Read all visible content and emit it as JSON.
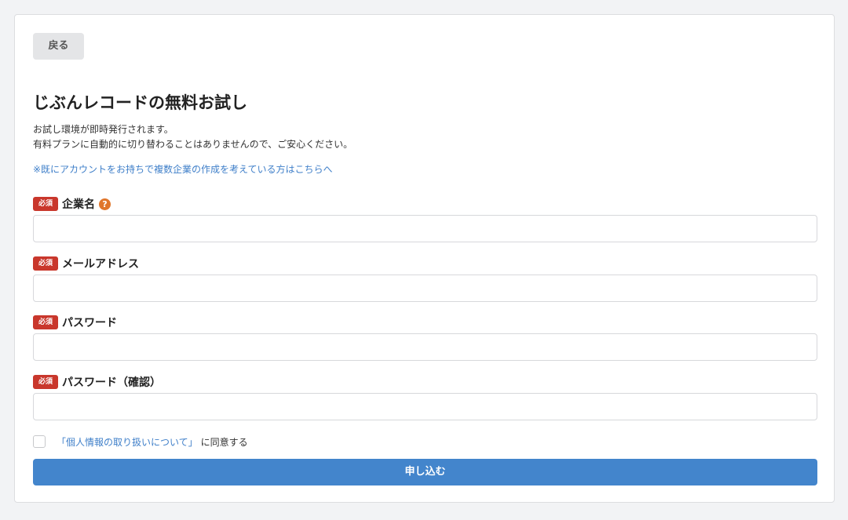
{
  "back_label": "戻る",
  "title": "じぶんレコードの無料お試し",
  "description": [
    "お試し環境が即時発行されます。",
    "有料プランに自動的に切り替わることはありませんので、ご安心ください。"
  ],
  "existing_account_link": "※既にアカウントをお持ちで複数企業の作成を考えている方はこちらへ",
  "required_badge": "必須",
  "help_icon": "?",
  "fields": [
    {
      "label": "企業名",
      "value": "",
      "has_help": true
    },
    {
      "label": "メールアドレス",
      "value": ""
    },
    {
      "label": "パスワード",
      "value": ""
    },
    {
      "label": "パスワード（確認）",
      "value": ""
    }
  ],
  "agreement": {
    "checked": false,
    "link_text": "「個人情報の取り扱いについて」",
    "suffix": "に同意する"
  },
  "submit_label": "申し込む",
  "colors": {
    "primary": "#4385cc",
    "link": "#3f7fc9",
    "required": "#c9372c",
    "help": "#e0762b"
  }
}
